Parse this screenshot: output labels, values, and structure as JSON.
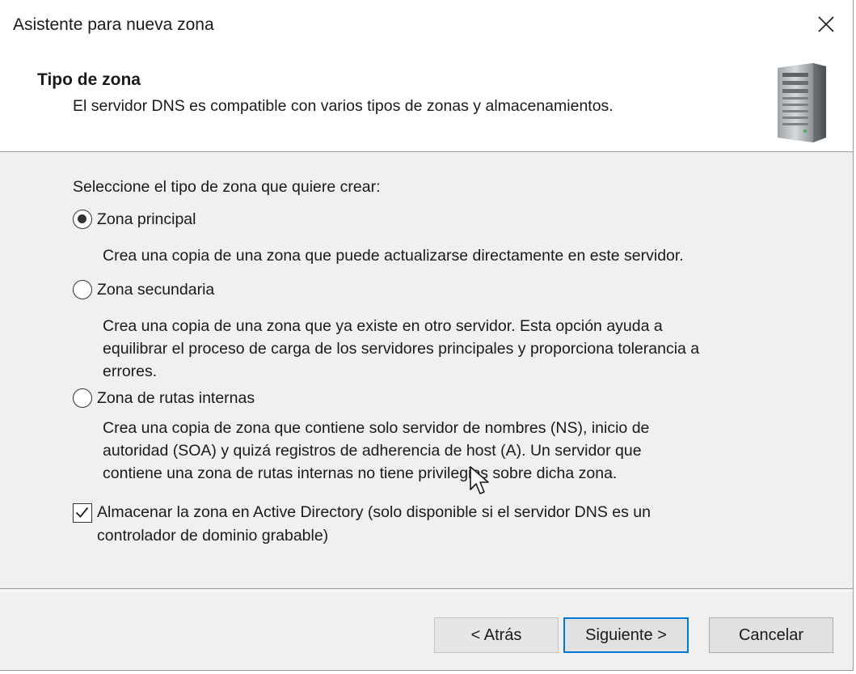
{
  "window": {
    "title": "Asistente para nueva zona"
  },
  "icons": {
    "close": "close-icon",
    "server": "server-icon",
    "cursor": "mouse-cursor"
  },
  "header": {
    "title": "Tipo de zona",
    "subtitle": "El servidor DNS es compatible con varios tipos de zonas y almacenamientos."
  },
  "content": {
    "prompt": "Seleccione el tipo de zona que quiere crear:",
    "options": [
      {
        "label": "Zona principal",
        "selected": true,
        "description": [
          "Crea una copia de una zona que puede actualizarse directamente en este servidor."
        ]
      },
      {
        "label": "Zona secundaria",
        "selected": false,
        "description": [
          "Crea una copia de una zona que ya existe en otro servidor. Esta opción ayuda a",
          "equilibrar el proceso de carga de los servidores principales y proporciona tolerancia a",
          "errores."
        ]
      },
      {
        "label": "Zona de rutas internas",
        "selected": false,
        "description": [
          "Crea una copia de zona que contiene solo servidor de nombres (NS), inicio de",
          "autoridad (SOA) y quizá registros de adherencia de host (A). Un servidor que",
          "contiene una zona de rutas internas no tiene privilegios sobre dicha zona."
        ]
      }
    ],
    "ad_checkbox": {
      "checked": true,
      "label_lines": [
        "Almacenar la zona en Active Directory (solo disponible si el servidor DNS es un",
        "controlador de dominio grabable)"
      ]
    }
  },
  "buttons": {
    "back": "< Atrás",
    "next": "Siguiente >",
    "cancel": "Cancelar"
  },
  "colors": {
    "accent": "#0078d7",
    "dialog_bg": "#f0f0f0",
    "header_bg": "#ffffff"
  }
}
